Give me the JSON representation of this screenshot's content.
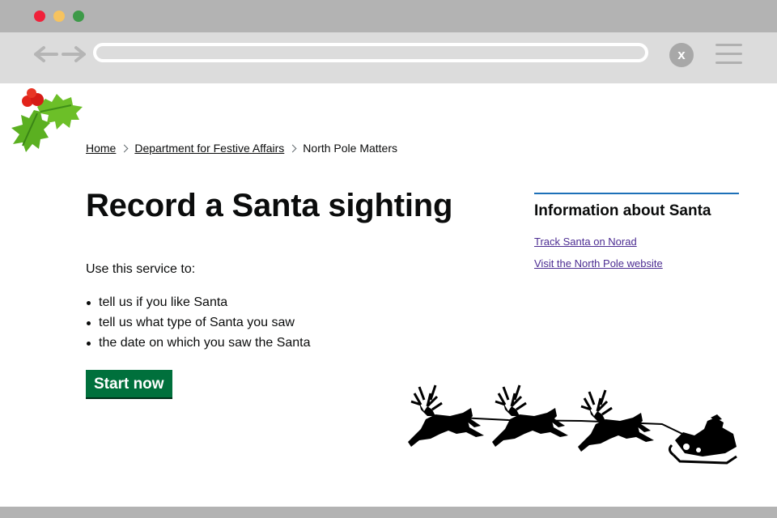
{
  "browser": {
    "window_controls": [
      "close-dot",
      "minimize-dot",
      "zoom-dot"
    ],
    "icons": [
      "back-arrow-icon",
      "forward-arrow-icon",
      "close-icon",
      "menu-icon"
    ],
    "close_glyph": "x",
    "address_bar_value": ""
  },
  "colors": {
    "titlebar": "#b3b3b3",
    "toolbar": "#dcdcdc",
    "link": "#4c2c92",
    "accent_border": "#1d70b8",
    "start_button": "#00703c"
  },
  "decorations": [
    "holly-icon",
    "santa-sleigh-reindeer-illustration"
  ],
  "breadcrumb": {
    "items": [
      {
        "label": "Home",
        "link": true
      },
      {
        "label": "Department for Festive Affairs",
        "link": true
      },
      {
        "label": "North Pole Matters",
        "link": false
      }
    ]
  },
  "main": {
    "title": "Record a Santa sighting",
    "intro": "Use this service to:",
    "bullets": [
      "tell us if you like Santa",
      "tell us what type of Santa you saw",
      "the date on which you saw the Santa"
    ],
    "start_button": "Start now"
  },
  "related": {
    "heading": "Information about Santa",
    "links": [
      "Track Santa on Norad",
      "Visit the North Pole website"
    ]
  }
}
